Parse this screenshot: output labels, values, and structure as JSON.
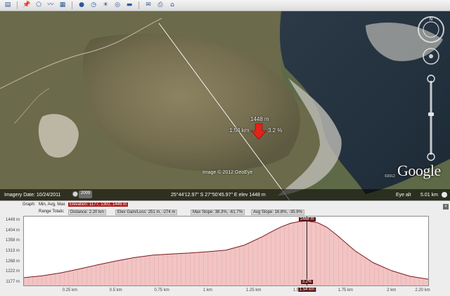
{
  "toolbar": {
    "buttons": [
      {
        "name": "sidebar-toggle-icon",
        "glyph": "▤"
      },
      {
        "name": "placemark-icon",
        "glyph": "📌"
      },
      {
        "name": "polygon-icon",
        "glyph": "⬠"
      },
      {
        "name": "path-icon",
        "glyph": "〰"
      },
      {
        "name": "image-overlay-icon",
        "glyph": "▦"
      },
      {
        "name": "tour-icon",
        "glyph": "●"
      },
      {
        "name": "historical-imagery-icon",
        "glyph": "◷"
      },
      {
        "name": "sunlight-icon",
        "glyph": "☀"
      },
      {
        "name": "planet-icon",
        "glyph": "◎"
      },
      {
        "name": "ruler-icon",
        "glyph": "▬"
      },
      {
        "name": "email-icon",
        "glyph": "✉"
      },
      {
        "name": "print-icon",
        "glyph": "⎙"
      },
      {
        "name": "view-in-maps-icon",
        "glyph": "⌂"
      }
    ]
  },
  "map": {
    "elevation": "1448 m",
    "distance": "1.54 km",
    "slope": "3.2 %",
    "credit": "Image © 2012 GeoEye",
    "copyright_small": "©2012",
    "logo": "Google",
    "status": {
      "date": "Imagery Date: 10/24/2011",
      "year": "2009",
      "coords": "25°44'12.97\" S  27°50'45.97\" E  elev 1448 m",
      "eye_label": "Eye alt",
      "eye_value": "5.01 km"
    }
  },
  "profile": {
    "graph_label": "Graph:",
    "min_avg_max": "Min, Avg, Max",
    "elevation_label": "Elevation:",
    "elevation_value": "1177, 1302, 1449 m",
    "range_label": "Range Totals:",
    "distance_label": "Distance:",
    "distance_value": "2.20 km",
    "gain_label": "Elev Gain/Loss:",
    "gain_value": "251 m, -274 m",
    "max_slope_label": "Max Slope:",
    "max_slope_value": "38.3%, -61.7%",
    "avg_slope_label": "Avg Slope:",
    "avg_slope_value": "16.8%, -35.9%",
    "close_glyph": "×",
    "peak_label": "1448 m",
    "cursor_slope": "3.2%",
    "cursor_distance": "1.54 km"
  },
  "chart_data": {
    "type": "area",
    "title": "",
    "xlabel": "",
    "ylabel": "",
    "x_unit": "km",
    "y_unit": "m",
    "xlim": [
      0,
      2.2
    ],
    "ylim": [
      1177,
      1449
    ],
    "yticks": [
      "1449 m",
      "1404 m",
      "1358 m",
      "1313 m",
      "1268 m",
      "1222 m",
      "1177 m"
    ],
    "xticks": [
      "0.25 km",
      "0.5 km",
      "0.75 km",
      "1 km",
      "1.25 km",
      "1.5 km",
      "1.75 km",
      "2 km",
      "2.20 km"
    ],
    "x": [
      0,
      0.1,
      0.2,
      0.3,
      0.4,
      0.5,
      0.6,
      0.7,
      0.8,
      0.9,
      1.0,
      1.1,
      1.2,
      1.3,
      1.35,
      1.4,
      1.45,
      1.5,
      1.54,
      1.6,
      1.65,
      1.7,
      1.8,
      1.9,
      2.0,
      2.1,
      2.2
    ],
    "series": [
      {
        "values": [
          1199,
          1207,
          1220,
          1237,
          1255,
          1272,
          1287,
          1298,
          1303,
          1307,
          1313,
          1320,
          1342,
          1380,
          1402,
          1422,
          1438,
          1446,
          1448,
          1440,
          1420,
          1388,
          1318,
          1265,
          1230,
          1205,
          1192
        ]
      }
    ],
    "cursor": {
      "x": 1.54,
      "y": 1448
    },
    "colors": {
      "fill": "#f2c4c4",
      "stroke": "#7a1a1a",
      "cursor": "#222222",
      "label_bg": "#5a1010"
    },
    "grid": false,
    "legend": "none"
  }
}
